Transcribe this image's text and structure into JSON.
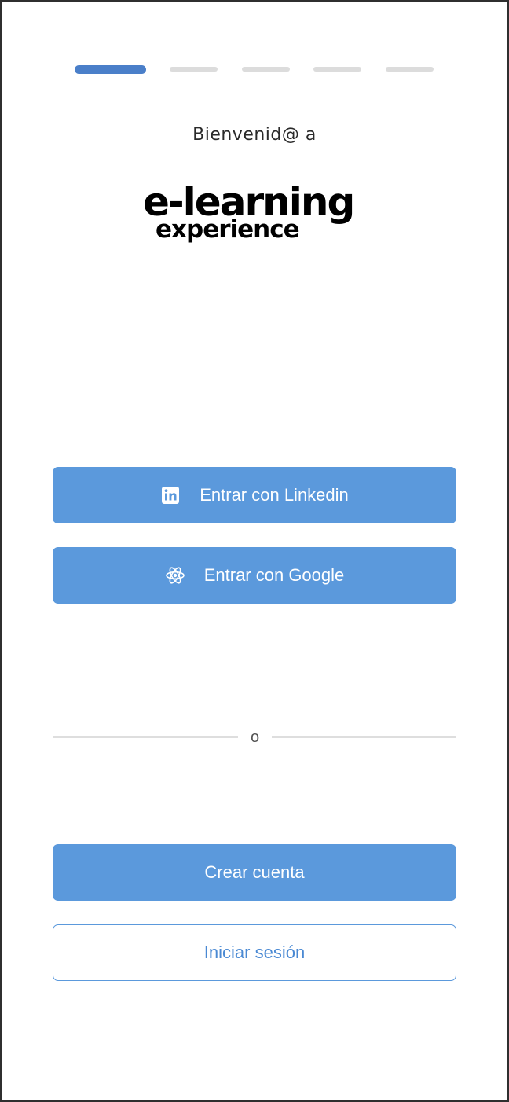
{
  "onboarding": {
    "steps_total": 5,
    "current_step": 1,
    "welcome_text": "Bienvenid@ a",
    "logo": {
      "text_line1": "e-learning",
      "text_line2": "experience"
    }
  },
  "social_login": {
    "linkedin_label": "Entrar con Linkedin",
    "linkedin_icon": "linkedin-icon",
    "google_label": "Entrar con Google",
    "google_icon": "atom-icon"
  },
  "divider": {
    "text": "o"
  },
  "account": {
    "create_label": "Crear cuenta",
    "login_label": "Iniciar sesión"
  },
  "colors": {
    "primary": "#5b99dc",
    "step_active": "#4a7fc9",
    "step_inactive": "#dcdcdc",
    "outline_text": "#4a89d3"
  }
}
